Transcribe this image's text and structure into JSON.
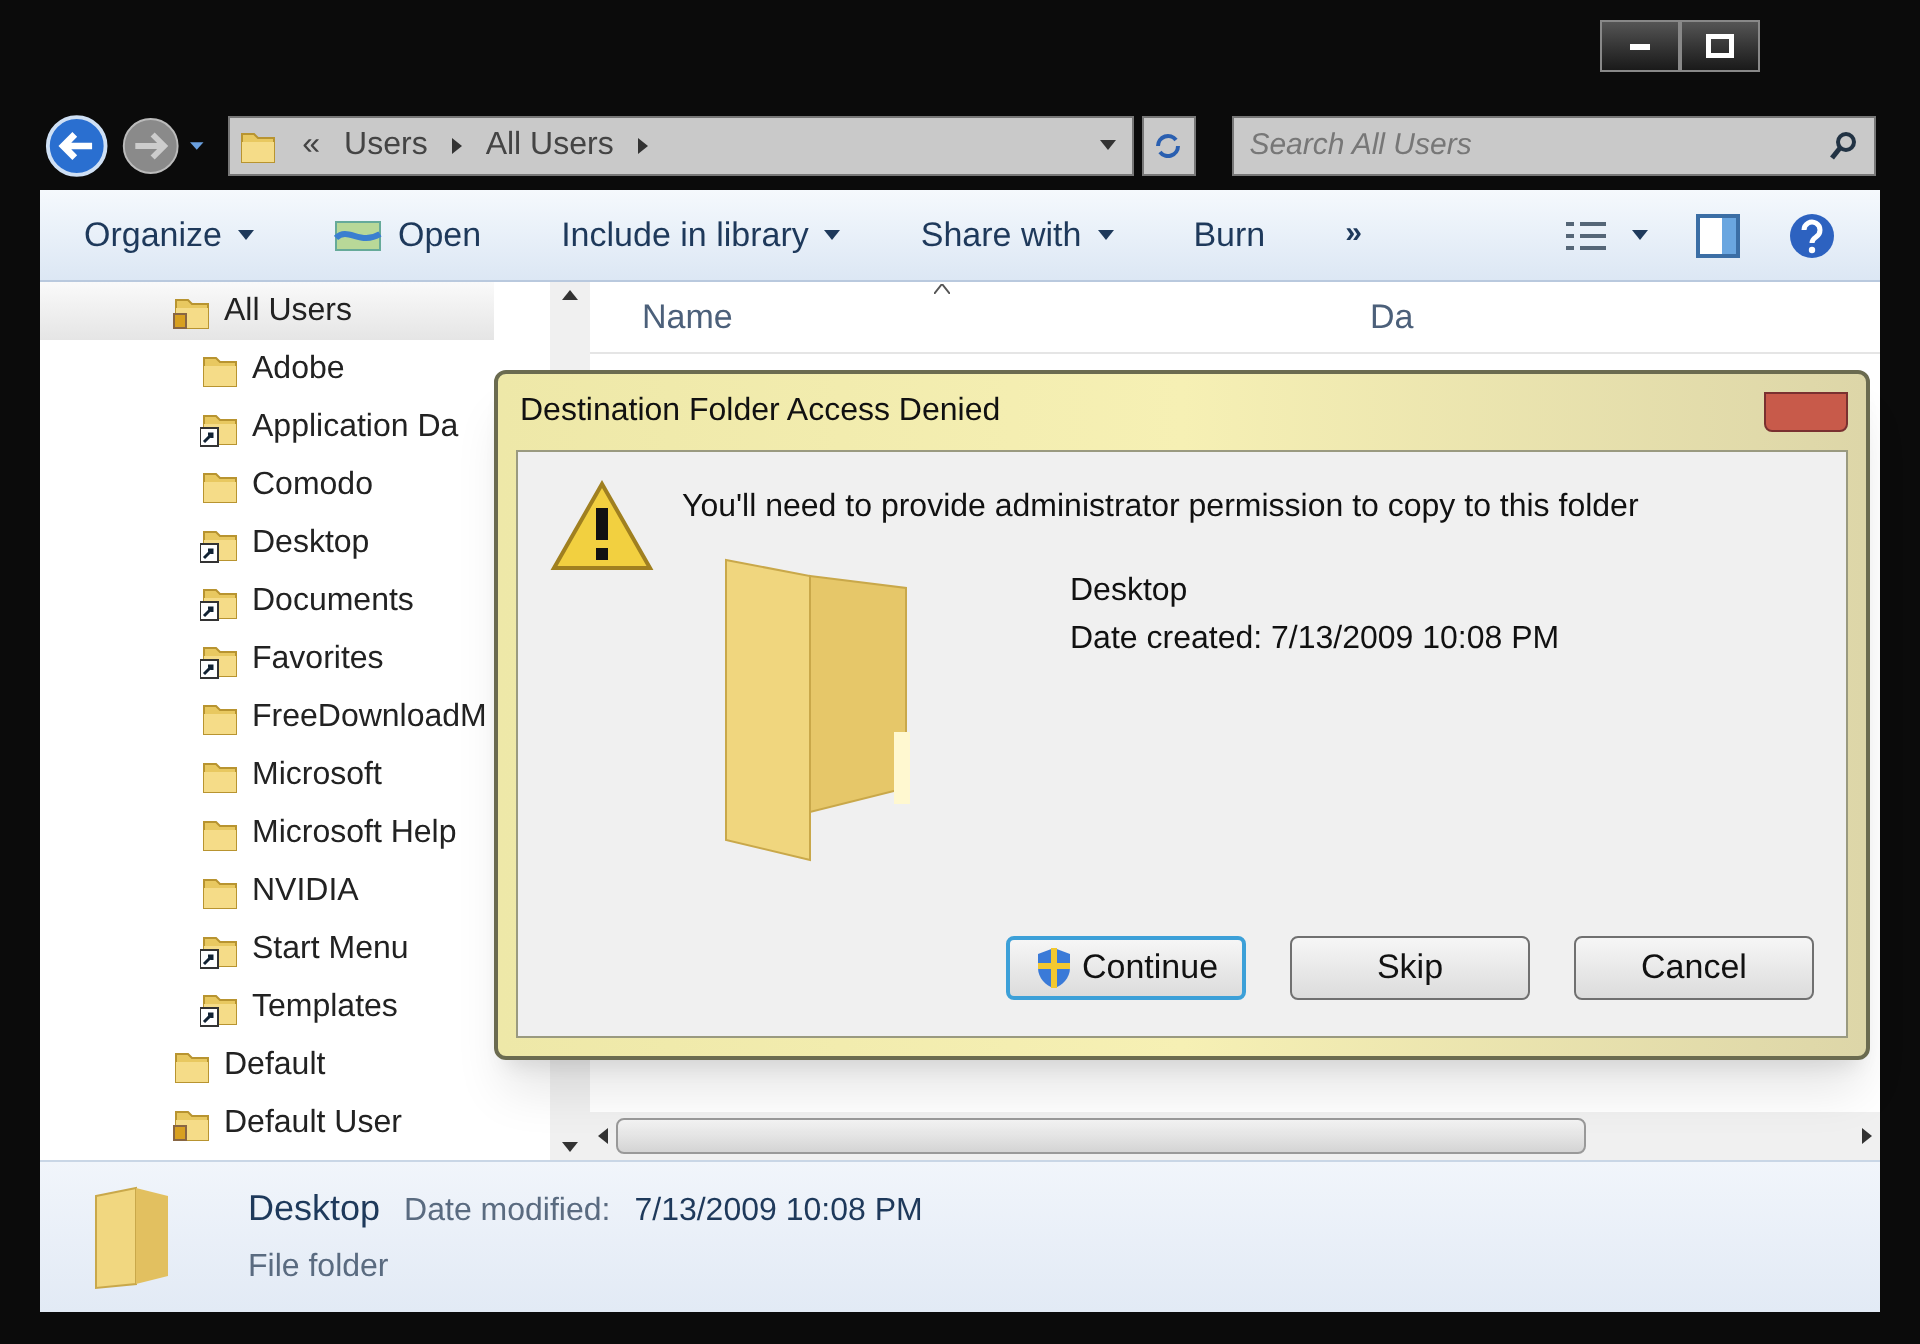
{
  "address_bar": {
    "overflow": "«",
    "segments": [
      "Users",
      "All Users"
    ]
  },
  "search": {
    "placeholder": "Search All Users"
  },
  "toolbar": {
    "items": [
      {
        "label": "Organize",
        "dropdown": true,
        "icon": false
      },
      {
        "label": "Open",
        "dropdown": false,
        "icon": true
      },
      {
        "label": "Include in library",
        "dropdown": true,
        "icon": false
      },
      {
        "label": "Share with",
        "dropdown": true,
        "icon": false
      },
      {
        "label": "Burn",
        "dropdown": false,
        "icon": false
      }
    ],
    "more": "»"
  },
  "tree": [
    {
      "label": "All Users",
      "kind": "locked",
      "selected": true,
      "children": [
        {
          "label": "Adobe",
          "kind": "folder",
          "selected": false
        },
        {
          "label": "Application Da",
          "kind": "shortcut",
          "selected": false
        },
        {
          "label": "Comodo",
          "kind": "folder",
          "selected": false
        },
        {
          "label": "Desktop",
          "kind": "shortcut",
          "selected": false
        },
        {
          "label": "Documents",
          "kind": "shortcut",
          "selected": false
        },
        {
          "label": "Favorites",
          "kind": "shortcut",
          "selected": false
        },
        {
          "label": "FreeDownloadM",
          "kind": "folder",
          "selected": false
        },
        {
          "label": "Microsoft",
          "kind": "folder",
          "selected": false
        },
        {
          "label": "Microsoft Help",
          "kind": "folder",
          "selected": false
        },
        {
          "label": "NVIDIA",
          "kind": "folder",
          "selected": false
        },
        {
          "label": "Start Menu",
          "kind": "shortcut",
          "selected": false
        },
        {
          "label": "Templates",
          "kind": "shortcut",
          "selected": false
        }
      ]
    },
    {
      "label": "Default",
      "kind": "folder",
      "selected": false
    },
    {
      "label": "Default User",
      "kind": "locked",
      "selected": false
    }
  ],
  "columns": [
    {
      "label": "Name"
    },
    {
      "label": "Da"
    }
  ],
  "dialog": {
    "title": "Destination Folder Access Denied",
    "message": "You'll need to provide administrator permission to copy to this folder",
    "item_name": "Desktop",
    "item_detail": "Date created: 7/13/2009 10:08 PM",
    "buttons": [
      {
        "label": "Continue",
        "shield": true,
        "selected": true
      },
      {
        "label": "Skip",
        "shield": false,
        "selected": false
      },
      {
        "label": "Cancel",
        "shield": false,
        "selected": false
      }
    ]
  },
  "details_pane": {
    "name": "Desktop",
    "field_label": "Date modified:",
    "field_value": "7/13/2009 10:08 PM",
    "type": "File folder"
  }
}
